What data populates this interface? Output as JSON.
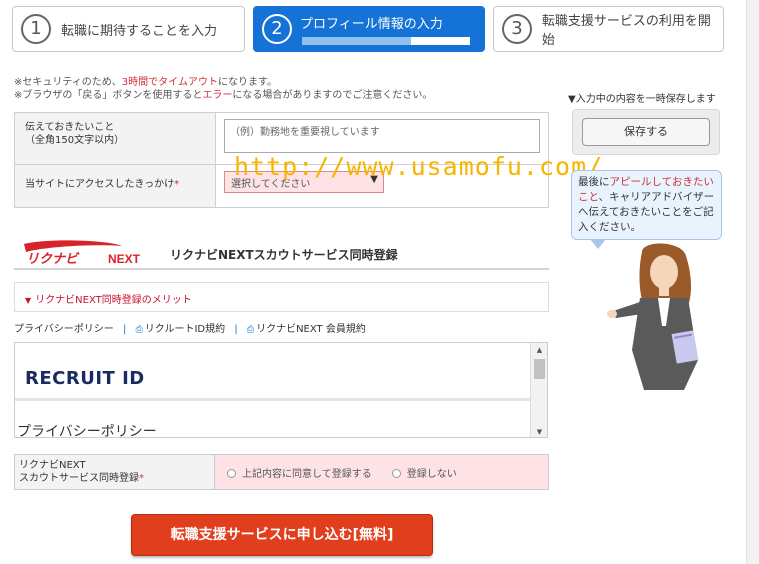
{
  "steps": [
    {
      "num": "1",
      "label": "転職に期待することを入力"
    },
    {
      "num": "2",
      "label": "プロフィール情報の入力",
      "progress": 0.65
    },
    {
      "num": "3",
      "label": "転職支援サービスの利用を開始"
    }
  ],
  "notice": {
    "line1_a": "※セキュリティのため、",
    "line1_b": "3時間でタイムアウト",
    "line1_c": "になります。",
    "line2_a": "※ブラウザの「戻る」ボタンを使用すると",
    "line2_b": "エラー",
    "line2_c": "になる場合がありますのでご注意ください。"
  },
  "form": {
    "message_label_1": "伝えておきたいこと",
    "message_label_2": "（全角150文字以内）",
    "message_placeholder": "（例）勤務地を重要視しています",
    "access_label": "当サイトにアクセスしたきっかけ",
    "access_required": "*",
    "access_selected": "選択してください",
    "select_arrow": "▼"
  },
  "watermark": "http://www.usamofu.com/",
  "save": {
    "caption": "▼入力中の内容を一時保存します",
    "button": "保存する"
  },
  "bubble": {
    "text_a": "最後に",
    "text_b": "アピールしておきたいこと",
    "text_c": "、キャリアアドバイザーへ伝えておきたいことをご記入ください。"
  },
  "rikunabi": {
    "logo_text": "リクナビ",
    "logo_next": "NEXT",
    "title": "リクナビNEXTスカウトサービス同時登録",
    "merit": "リクナビNEXT同時登録のメリット",
    "merit_icon": "chevron-down-icon"
  },
  "links": {
    "privacy": "プライバシーポリシー",
    "sep": "|",
    "recruit_id_terms": "リクルートID規約",
    "rikunabi_terms": "リクナビNEXT 会員規約"
  },
  "policy": {
    "logo": "RECRUIT ID",
    "title": "プライバシーポリシー"
  },
  "registration": {
    "label_1": "リクナビNEXT",
    "label_2": "スカウトサービス同時登録",
    "required": "*",
    "option_agree": "上記内容に同意して登録する",
    "option_decline": "登録しない"
  },
  "apply_button": "転職支援サービスに申し込む[無料]",
  "colors": {
    "accent_blue": "#1572d6",
    "required_red": "#d0303a",
    "apply_red": "#e03e1d",
    "watermark": "#f7b500"
  }
}
